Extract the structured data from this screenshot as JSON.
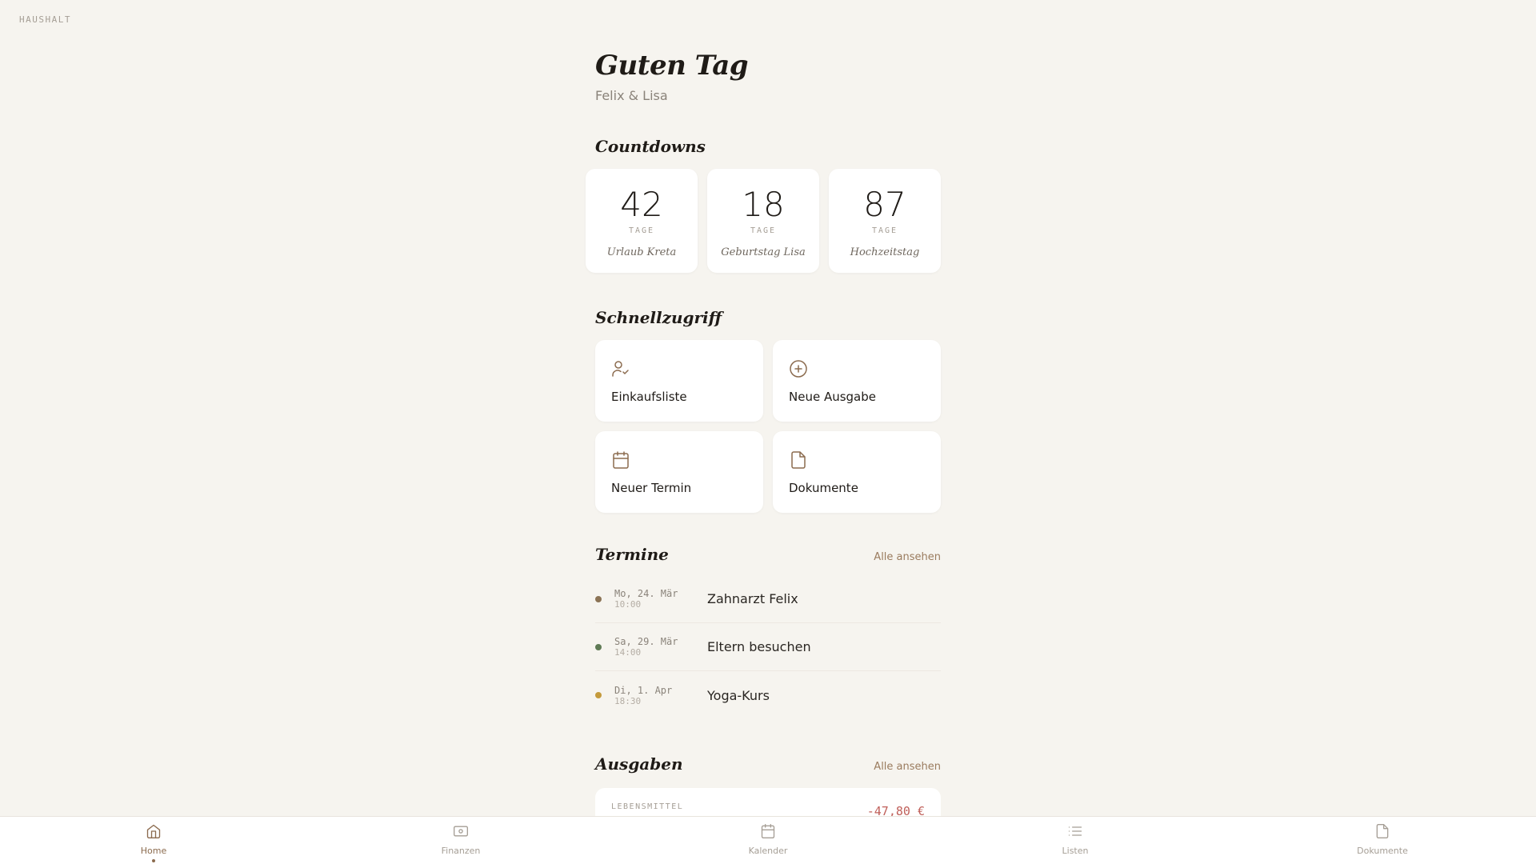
{
  "app": {
    "brand": "HAUSHALT"
  },
  "header": {
    "greeting": "Guten Tag",
    "subtitle": "Felix & Lisa"
  },
  "countdowns": {
    "title": "Countdowns",
    "items": [
      {
        "value": "42",
        "unit": "TAGE",
        "label": "Urlaub Kreta"
      },
      {
        "value": "18",
        "unit": "TAGE",
        "label": "Geburtstag Lisa"
      },
      {
        "value": "87",
        "unit": "TAGE",
        "label": "Hochzeitstag"
      }
    ]
  },
  "quick_access": {
    "title": "Schnellzugriff",
    "items": [
      {
        "label": "Einkaufsliste",
        "icon": "user-check-icon"
      },
      {
        "label": "Neue Ausgabe",
        "icon": "plus-circle-icon"
      },
      {
        "label": "Neuer Termin",
        "icon": "calendar-icon"
      },
      {
        "label": "Dokumente",
        "icon": "document-icon"
      }
    ]
  },
  "events": {
    "title": "Termine",
    "see_all": "Alle ansehen",
    "items": [
      {
        "day": "Mo, 24. Mär",
        "time": "10:00",
        "title": "Zahnarzt Felix",
        "color": "#8b7355"
      },
      {
        "day": "Sa, 29. Mär",
        "time": "14:00",
        "title": "Eltern besuchen",
        "color": "#5f7a55"
      },
      {
        "day": "Di, 1. Apr",
        "time": "18:30",
        "title": "Yoga-Kurs",
        "color": "#c49a3c"
      }
    ]
  },
  "expenses": {
    "title": "Ausgaben",
    "see_all": "Alle ansehen",
    "items": [
      {
        "category": "LEBENSMITTEL",
        "amount": "-47,80 €"
      }
    ]
  },
  "nav": {
    "items": [
      {
        "label": "Home",
        "icon": "home-icon",
        "active": true
      },
      {
        "label": "Finanzen",
        "icon": "wallet-icon"
      },
      {
        "label": "Kalender",
        "icon": "calendar-icon"
      },
      {
        "label": "Listen",
        "icon": "list-icon"
      },
      {
        "label": "Dokumente",
        "icon": "document-icon"
      }
    ]
  },
  "colors": {
    "background": "#f6f4ef",
    "accent": "#8b6b4e",
    "negative": "#c0605a"
  }
}
